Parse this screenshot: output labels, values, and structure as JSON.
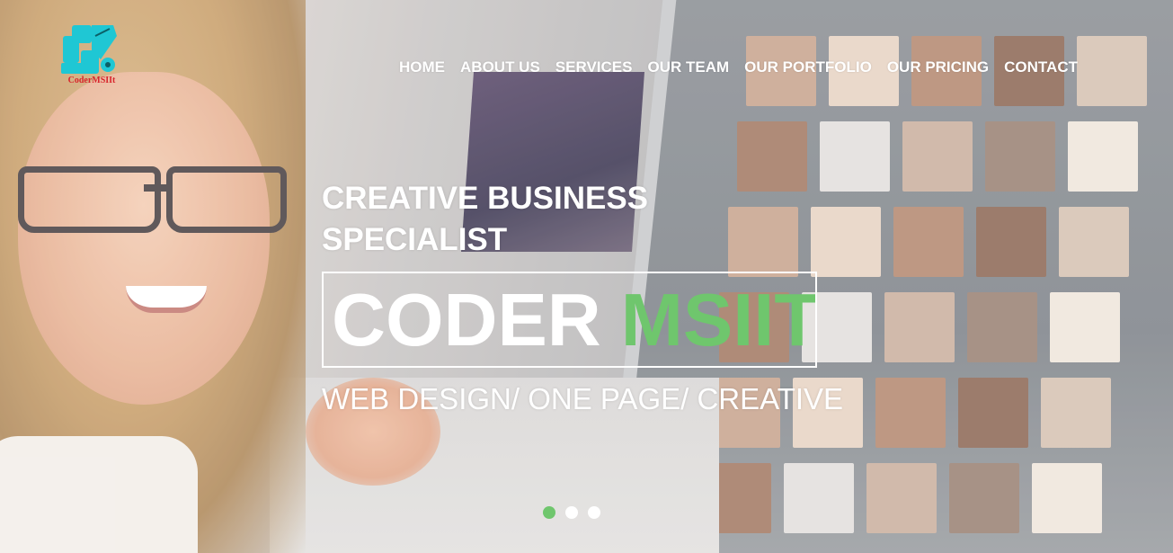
{
  "brand": {
    "logo_text": "CoderMSIIt",
    "logo_color": "#1fc7d4",
    "logo_text_color": "#d8242b"
  },
  "nav": {
    "items": [
      {
        "label": "HOME"
      },
      {
        "label": "ABOUT US"
      },
      {
        "label": "SERVICES"
      },
      {
        "label": "OUR TEAM"
      },
      {
        "label": "OUR PORTFOLIO"
      },
      {
        "label": "OUR PRICING"
      },
      {
        "label": "CONTACT"
      }
    ]
  },
  "slider": {
    "kicker": "CREATIVE BUSINESS SPECIALIST",
    "title_main": "CODER",
    "title_accent": "MSIIT",
    "tagline": "WEB DESIGN/ ONE PAGE/ CREATIVE",
    "active_slide": 1,
    "slide_count": 3,
    "accent_color": "#6fc66d"
  }
}
